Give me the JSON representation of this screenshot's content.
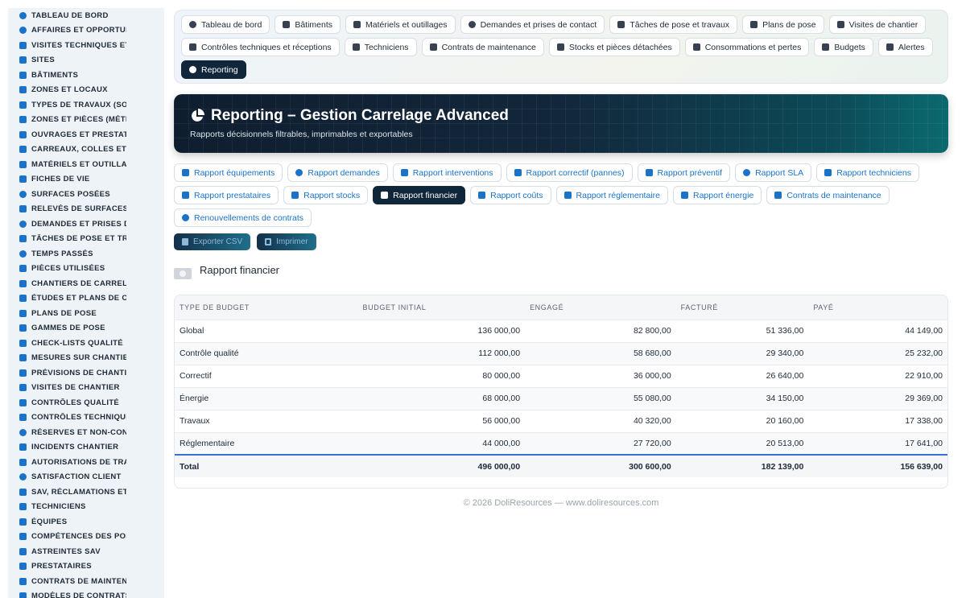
{
  "sidebar": {
    "items": [
      {
        "label": "TABLEAU DE BORD",
        "icon": "dashboard-icon"
      },
      {
        "label": "AFFAIRES ET OPPORTUNITÉS",
        "icon": "target-icon"
      },
      {
        "label": "VISITES TECHNIQUES ET AVANT-VENTE",
        "icon": "clipboard-icon"
      },
      {
        "label": "SITES",
        "icon": "map-pin-icon"
      },
      {
        "label": "BÂTIMENTS",
        "icon": "building-icon"
      },
      {
        "label": "ZONES ET LOCAUX",
        "icon": "layers-icon"
      },
      {
        "label": "TYPES DE TRAVAUX (SOLS, MURS)",
        "icon": "sitemap-icon"
      },
      {
        "label": "ZONES ET PIÈCES (MÉTRÉS)",
        "icon": "grid-icon"
      },
      {
        "label": "OUVRAGES ET PRESTATIONS",
        "icon": "list-icon"
      },
      {
        "label": "CARREAUX, COLLES ET JOINTS",
        "icon": "tile-icon"
      },
      {
        "label": "MATÉRIELS ET OUTILLAGES",
        "icon": "cogs-icon"
      },
      {
        "label": "FICHES DE VIE",
        "icon": "file-icon"
      },
      {
        "label": "SURFACES POSÉES",
        "icon": "gauge-icon"
      },
      {
        "label": "RELEVÉS DE SURFACES",
        "icon": "ruler-icon"
      },
      {
        "label": "DEMANDES ET PRISES DE CONTACT",
        "icon": "question-icon"
      },
      {
        "label": "TÂCHES DE POSE ET TRAVAUX",
        "icon": "tasks-icon"
      },
      {
        "label": "TEMPS PASSÉS",
        "icon": "clock-icon"
      },
      {
        "label": "PIÈCES UTILISÉES",
        "icon": "box-icon"
      },
      {
        "label": "CHANTIERS DE CARRELAGE",
        "icon": "hammer-icon"
      },
      {
        "label": "ÉTUDES ET PLANS DE CALEPINAGE",
        "icon": "drafting-icon"
      },
      {
        "label": "PLANS DE POSE",
        "icon": "calendar-icon"
      },
      {
        "label": "GAMMES DE POSE",
        "icon": "list-ul-icon"
      },
      {
        "label": "CHECK-LISTS QUALITÉ",
        "icon": "checklist-icon"
      },
      {
        "label": "MESURES SUR CHANTIER",
        "icon": "ruler-icon"
      },
      {
        "label": "PRÉVISIONS DE CHANTIER",
        "icon": "calendar-icon"
      },
      {
        "label": "VISITES DE CHANTIER",
        "icon": "visit-icon"
      },
      {
        "label": "CONTRÔLES QUALITÉ",
        "icon": "search-icon"
      },
      {
        "label": "CONTRÔLES TECHNIQUES",
        "icon": "clipboard-icon"
      },
      {
        "label": "RÉSERVES ET NON-CONFORMITÉS",
        "icon": "alert-circle-icon"
      },
      {
        "label": "INCIDENTS CHANTIER",
        "icon": "warning-icon"
      },
      {
        "label": "AUTORISATIONS DE TRAVAUX",
        "icon": "signature-icon"
      },
      {
        "label": "SATISFACTION CLIENT",
        "icon": "smile-icon"
      },
      {
        "label": "SAV, RÉCLAMATIONS ET GARANTIES",
        "icon": "comment-icon"
      },
      {
        "label": "TECHNICIENS",
        "icon": "hard-hat-icon"
      },
      {
        "label": "ÉQUIPES",
        "icon": "users-icon"
      },
      {
        "label": "COMPÉTENCES DES POSEURS",
        "icon": "star-icon"
      },
      {
        "label": "ASTREINTES SAV",
        "icon": "phone-icon"
      },
      {
        "label": "PRESTATAIRES",
        "icon": "handshake-icon"
      },
      {
        "label": "CONTRATS DE MAINTENANCE",
        "icon": "file-contract-icon"
      },
      {
        "label": "MODÈLES DE CONTRATS",
        "icon": "file-icon"
      }
    ]
  },
  "topnav": {
    "row1": [
      {
        "label": "Tableau de bord",
        "icon": "dashboard-icon"
      },
      {
        "label": "Bâtiments",
        "icon": "building-icon"
      },
      {
        "label": "Matériels et outillages",
        "icon": "cogs-icon"
      },
      {
        "label": "Demandes et prises de contact",
        "icon": "question-icon"
      },
      {
        "label": "Tâches de pose et travaux",
        "icon": "tasks-icon"
      },
      {
        "label": "Plans de pose",
        "icon": "calendar-icon"
      },
      {
        "label": "Visites de chantier",
        "icon": "visit-icon"
      }
    ],
    "row2": [
      {
        "label": "Contrôles techniques et réceptions",
        "icon": "clipboard-icon"
      },
      {
        "label": "Techniciens",
        "icon": "hard-hat-icon"
      },
      {
        "label": "Contrats de maintenance",
        "icon": "file-contract-icon"
      },
      {
        "label": "Stocks et pièces détachées",
        "icon": "sitemap-icon"
      },
      {
        "label": "Consommations et pertes",
        "icon": "bolt-icon"
      },
      {
        "label": "Budgets",
        "icon": "money-icon"
      },
      {
        "label": "Alertes",
        "icon": "bell-icon"
      }
    ],
    "row3": [
      {
        "label": "Reporting",
        "icon": "pie-chart-icon"
      }
    ]
  },
  "hero": {
    "title": "Reporting – Gestion Carrelage Advanced",
    "subtitle": "Rapports décisionnels filtrables, imprimables et exportables"
  },
  "report_tabs": {
    "row1": [
      {
        "label": "Rapport équipements",
        "icon": "cogs-icon"
      },
      {
        "label": "Rapport demandes",
        "icon": "question-icon"
      },
      {
        "label": "Rapport interventions",
        "icon": "tasks-icon"
      },
      {
        "label": "Rapport correctif (pannes)",
        "icon": "tools-icon"
      },
      {
        "label": "Rapport préventif",
        "icon": "calendar-icon"
      },
      {
        "label": "Rapport SLA",
        "icon": "stopwatch-icon"
      },
      {
        "label": "Rapport techniciens",
        "icon": "hard-hat-icon"
      }
    ],
    "row2": [
      {
        "label": "Rapport prestataires",
        "icon": "handshake-icon"
      },
      {
        "label": "Rapport stocks",
        "icon": "sitemap-icon"
      },
      {
        "label": "Rapport financier",
        "icon": "money-icon"
      },
      {
        "label": "Rapport coûts",
        "icon": "coins-icon"
      },
      {
        "label": "Rapport réglementaire",
        "icon": "clipboard-icon"
      },
      {
        "label": "Rapport énergie",
        "icon": "bolt-icon"
      },
      {
        "label": "Contrats de maintenance",
        "icon": "file-contract-icon"
      }
    ],
    "row3": [
      {
        "label": "Renouvellements de contrats",
        "icon": "sync-icon"
      }
    ]
  },
  "actions": {
    "export_label": "Exporter CSV",
    "print_label": "Imprimer"
  },
  "section": {
    "title": "Rapport financier"
  },
  "table": {
    "headers": [
      "TYPE DE BUDGET",
      "BUDGET INITIAL",
      "ENGAGÉ",
      "FACTURÉ",
      "PAYÉ"
    ],
    "rows": [
      [
        "Global",
        "136 000,00",
        "82 800,00",
        "51 336,00",
        "44 149,00"
      ],
      [
        "Contrôle qualité",
        "112 000,00",
        "58 680,00",
        "29 340,00",
        "25 232,00"
      ],
      [
        "Correctif",
        "80 000,00",
        "36 000,00",
        "26 640,00",
        "22 910,00"
      ],
      [
        "Énergie",
        "68 000,00",
        "55 080,00",
        "34 150,00",
        "29 369,00"
      ],
      [
        "Travaux",
        "56 000,00",
        "40 320,00",
        "20 160,00",
        "17 338,00"
      ],
      [
        "Réglementaire",
        "44 000,00",
        "27 720,00",
        "20 513,00",
        "17 641,00"
      ]
    ],
    "total": [
      "Total",
      "496 000,00",
      "300 600,00",
      "182 139,00",
      "156 639,00"
    ]
  },
  "footer": {
    "text": "© 2026 DoliResources — www.doliresources.com"
  },
  "colors": {
    "accent": "#1a73c8",
    "dark": "#10263a",
    "total_border": "#3b6fd1"
  }
}
